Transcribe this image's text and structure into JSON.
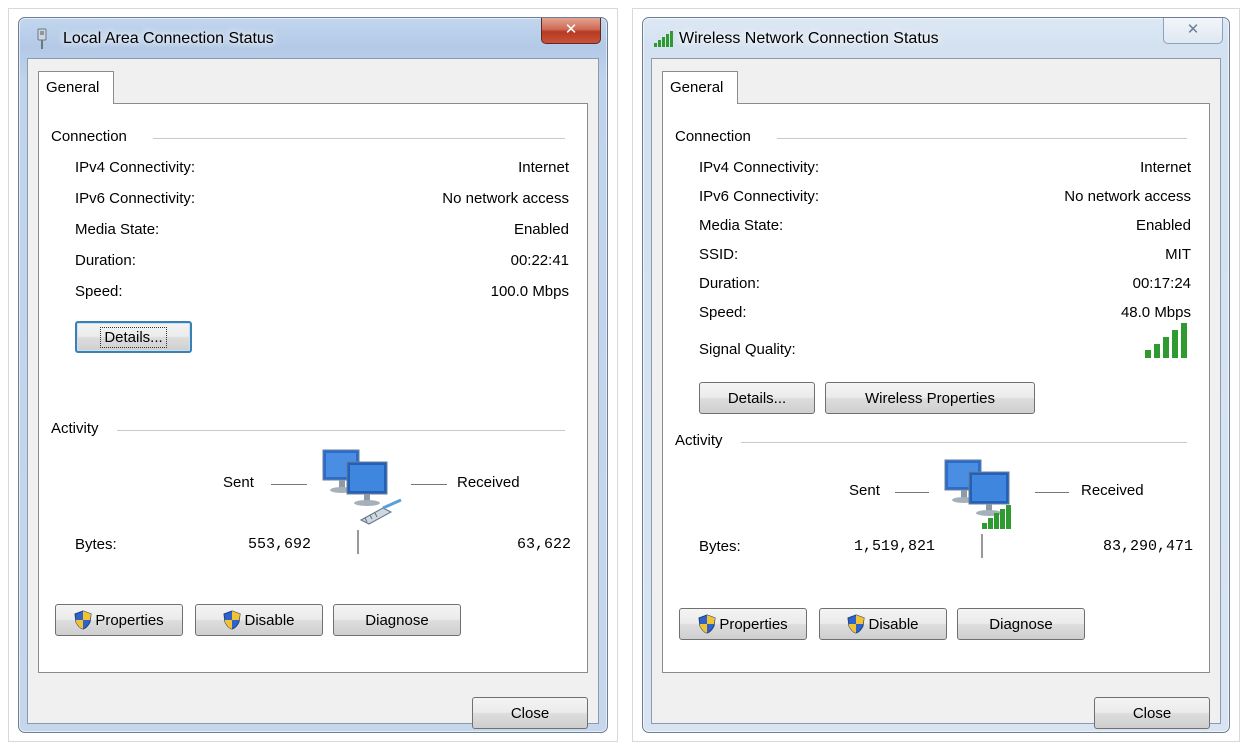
{
  "left": {
    "title": "Local Area Connection Status",
    "tab": "General",
    "connection": {
      "label": "Connection",
      "rows": [
        {
          "label": "IPv4 Connectivity:",
          "value": "Internet"
        },
        {
          "label": "IPv6 Connectivity:",
          "value": "No network access"
        },
        {
          "label": "Media State:",
          "value": "Enabled"
        },
        {
          "label": "Duration:",
          "value": "00:22:41"
        },
        {
          "label": "Speed:",
          "value": "100.0 Mbps"
        }
      ],
      "details_button": "Details..."
    },
    "activity": {
      "label": "Activity",
      "sent": "Sent",
      "received": "Received",
      "bytes_label": "Bytes:",
      "bytes_sent": "553,692",
      "bytes_received": "63,622"
    },
    "buttons": {
      "properties": "Properties",
      "disable": "Disable",
      "diagnose": "Diagnose",
      "close": "Close"
    }
  },
  "right": {
    "title": "Wireless Network Connection Status",
    "tab": "General",
    "connection": {
      "label": "Connection",
      "rows": [
        {
          "label": "IPv4 Connectivity:",
          "value": "Internet"
        },
        {
          "label": "IPv6 Connectivity:",
          "value": "No network access"
        },
        {
          "label": "Media State:",
          "value": "Enabled"
        },
        {
          "label": "SSID:",
          "value": "MIT"
        },
        {
          "label": "Duration:",
          "value": "00:17:24"
        },
        {
          "label": "Speed:",
          "value": "48.0 Mbps"
        }
      ],
      "signal_label": "Signal Quality:",
      "signal_bars": 5,
      "details_button": "Details...",
      "wireless_properties_button": "Wireless Properties"
    },
    "activity": {
      "label": "Activity",
      "sent": "Sent",
      "received": "Received",
      "bytes_label": "Bytes:",
      "bytes_sent": "1,519,821",
      "bytes_received": "83,290,471"
    },
    "buttons": {
      "properties": "Properties",
      "disable": "Disable",
      "diagnose": "Diagnose",
      "close": "Close"
    }
  },
  "colors": {
    "signal_green": "#2f9a2f",
    "close_red": "#c9533a",
    "focus_blue": "#3c7fb1"
  },
  "icons": [
    "network-adapter-icon",
    "wireless-signal-icon",
    "close-icon",
    "shield-icon",
    "computers-icon",
    "ethernet-plug-icon"
  ]
}
